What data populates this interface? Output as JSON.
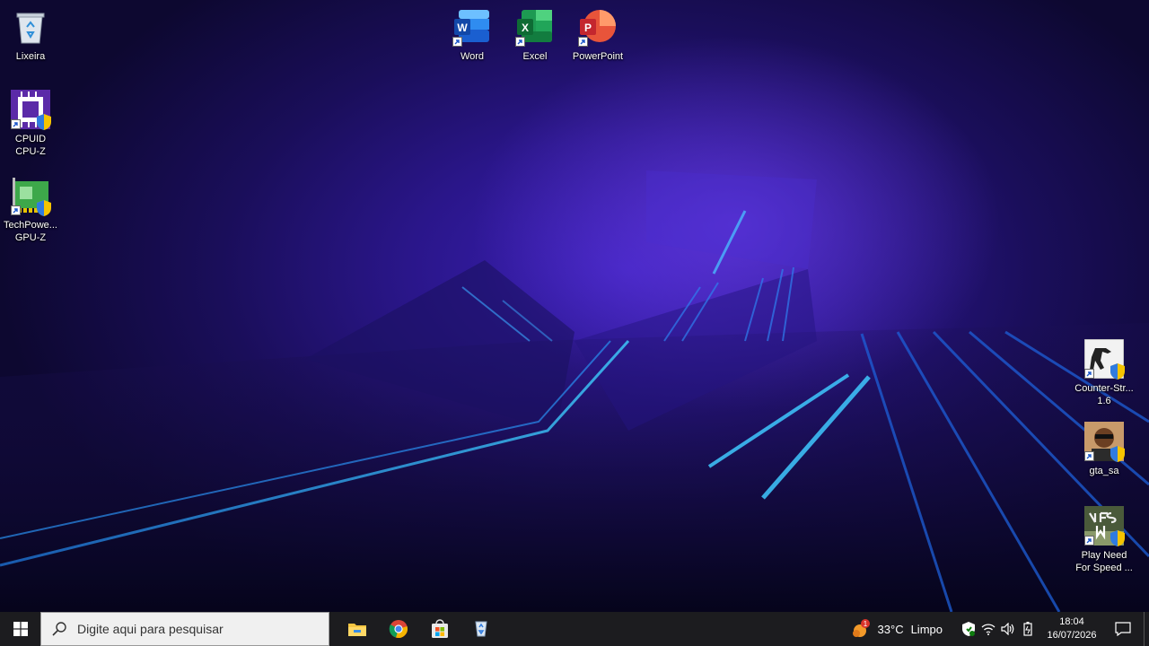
{
  "desktop": {
    "left_icons": [
      {
        "name": "recycle-bin",
        "label": "Lixeira"
      },
      {
        "name": "cpuz",
        "label": "CPUID\nCPU-Z"
      },
      {
        "name": "gpuz",
        "label": "TechPowe...\nGPU-Z"
      }
    ],
    "top_icons": [
      {
        "name": "word",
        "label": "Word"
      },
      {
        "name": "excel",
        "label": "Excel"
      },
      {
        "name": "powerpoint",
        "label": "PowerPoint"
      }
    ],
    "right_icons": [
      {
        "name": "counter-strike",
        "label": "Counter-Str...\n1.6"
      },
      {
        "name": "gta-sa",
        "label": "gta_sa"
      },
      {
        "name": "need-for-speed",
        "label": "Play Need\nFor Speed ..."
      }
    ]
  },
  "taskbar": {
    "search_placeholder": "Digite aqui para pesquisar",
    "pinned_apps": [
      "file-explorer-icon",
      "chrome-icon",
      "microsoft-store-icon",
      "windows-tool-icon"
    ],
    "weather": {
      "temp": "33°C",
      "condition": "Limpo",
      "alert_count": "1"
    },
    "clock": {
      "time": "18:04",
      "date": "16/07/2026"
    }
  },
  "colors": {
    "taskbar_bg": "#1c1c1f",
    "wallpaper_accent": "#3a1fb5",
    "neon_line": "#2fb5ff"
  }
}
